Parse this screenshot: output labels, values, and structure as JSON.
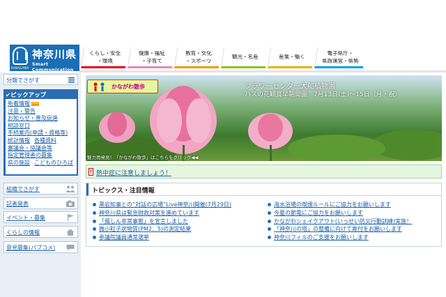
{
  "header": {
    "logo_title": "神奈川県",
    "logo_sub": "Smart Communication",
    "logo_tiny": "KANAGAWA",
    "nav": [
      {
        "line1": "くらし・安全",
        "line2": "・環境"
      },
      {
        "line1": "健康・福祉",
        "line2": "・子育て"
      },
      {
        "line1": "教育・文化",
        "line2": "・スポーツ"
      },
      {
        "line1": "観光・名産",
        "line2": ""
      },
      {
        "line1": "産業・働く",
        "line2": ""
      },
      {
        "line1": "電子県庁・",
        "line2": "県政運営・県勢"
      }
    ]
  },
  "sidebar": {
    "search_label": "分類でさがす",
    "pickup_title": "✔ピックアップ",
    "pickup_rows": [
      [
        "新着情報"
      ],
      [
        "注意・警告"
      ],
      [
        "お知らせ・普及促進"
      ],
      [
        "相談窓口"
      ],
      [
        "手続案内(申請・資格等)"
      ],
      [
        "統計情報",
        "各種資料"
      ],
      [
        "審議会・協議会等"
      ],
      [
        "指定管理者の募集"
      ],
      [
        "県の施設",
        "こどものひろば"
      ]
    ],
    "rss_label": "RSS",
    "rows": [
      "組織でさがす",
      "記者発表",
      "イベント・募集",
      "くらしの情報",
      "意見募集(パブコメ)"
    ]
  },
  "banner": {
    "tag": "かながわ散歩",
    "title": "フラワーセンター大船植物園",
    "sub": "ハスの花観賞早朝開園　7月13日(土)〜15日（月・祝）",
    "caption": "魅力再発見！「かながわ散歩」はこちらをクリック◀◀"
  },
  "alert": {
    "mark": "!",
    "text": "熱中症に注意しましょう！"
  },
  "topics": {
    "title": "トピックス・注目情報",
    "left": [
      "黒岩知事との“対話の広場”Live神奈川開催(7月29日)",
      "神奈川県は緊急財政対策を進めています",
      "「風しん非常事態」を宣言しました",
      "微小粒子状物質(PM2．5)の測定結果",
      "参議院議員通常選挙"
    ],
    "right": [
      "海水浴場の喫煙ルールにご協力をお願いします",
      "今夏の節電にご協力をお願いします",
      "かながわシェイクアウト(いっせい防災行動訓練)実施！",
      "「神奈川の塔」の整備に向けて寄付をお願いします",
      "神奈川フィルのご支援をお願いします"
    ]
  },
  "colors": {
    "brand": "#1a6fb5",
    "link": "#1a5fa8",
    "alert_bg": "#e5f6df"
  }
}
